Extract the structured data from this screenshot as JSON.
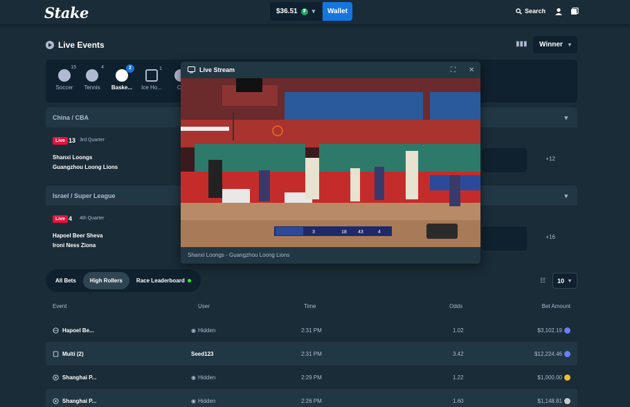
{
  "header": {
    "logo": "Stake",
    "balance": "$36.51",
    "coin_symbol": "₮",
    "wallet_label": "Wallet",
    "search_label": "Search"
  },
  "live_events": {
    "title": "Live Events",
    "market_select": "Winner"
  },
  "sports": [
    {
      "label": "Soccer",
      "count": "15",
      "icon": "soccer-icon"
    },
    {
      "label": "Tennis",
      "count": "4",
      "icon": "tennis-icon"
    },
    {
      "label": "Baske...",
      "count": "2",
      "icon": "basketball-icon"
    },
    {
      "label": "Ice Ho...",
      "count": "1",
      "icon": "ice-hockey-icon"
    },
    {
      "label": "Cri",
      "count": "",
      "icon": "cricket-icon"
    }
  ],
  "events": [
    {
      "league": "China / CBA",
      "live": "Live",
      "score": "13",
      "period": "3rd Quarter",
      "home": "Shanxi Loongs",
      "away": "Guangzhou Loong Lions",
      "more": "+12"
    },
    {
      "league": "Israel / Super League",
      "live": "Live",
      "score": "4",
      "period": "4th Quarter",
      "home": "Hapoel Beer Sheva",
      "away": "Ironi Ness Ziona",
      "more": "+16"
    }
  ],
  "stream": {
    "title": "Live Stream",
    "caption": "Shanxi Loongs - Guangzhou Loong Lions",
    "scoreboard": {
      "q": "3",
      "home": "18",
      "mid": "43",
      "away": "4"
    }
  },
  "bets": {
    "tabs": [
      "All Bets",
      "High Rollers",
      "Race Leaderboard"
    ],
    "rows_count": "10",
    "columns": {
      "event": "Event",
      "user": "User",
      "time": "Time",
      "odds": "Odds",
      "amount": "Bet Amount"
    },
    "rows": [
      {
        "event": "Hapoel Be...",
        "user": "Hidden",
        "time": "2:31 PM",
        "odds": "1.02",
        "amount": "$3,102.19",
        "coin_color": "#6c7dff"
      },
      {
        "event": "Multi (2)",
        "user": "Seed123",
        "time": "2:31 PM",
        "odds": "3.42",
        "amount": "$12,224.46",
        "coin_color": "#6c7dff"
      },
      {
        "event": "Shanghai P...",
        "user": "Hidden",
        "time": "2:29 PM",
        "odds": "1.22",
        "amount": "$1,000.00",
        "coin_color": "#f3ba2f"
      },
      {
        "event": "Shanghai P...",
        "user": "Hidden",
        "time": "2:26 PM",
        "odds": "1.60",
        "amount": "$1,148.81",
        "coin_color": "#c8c8c8"
      }
    ]
  }
}
